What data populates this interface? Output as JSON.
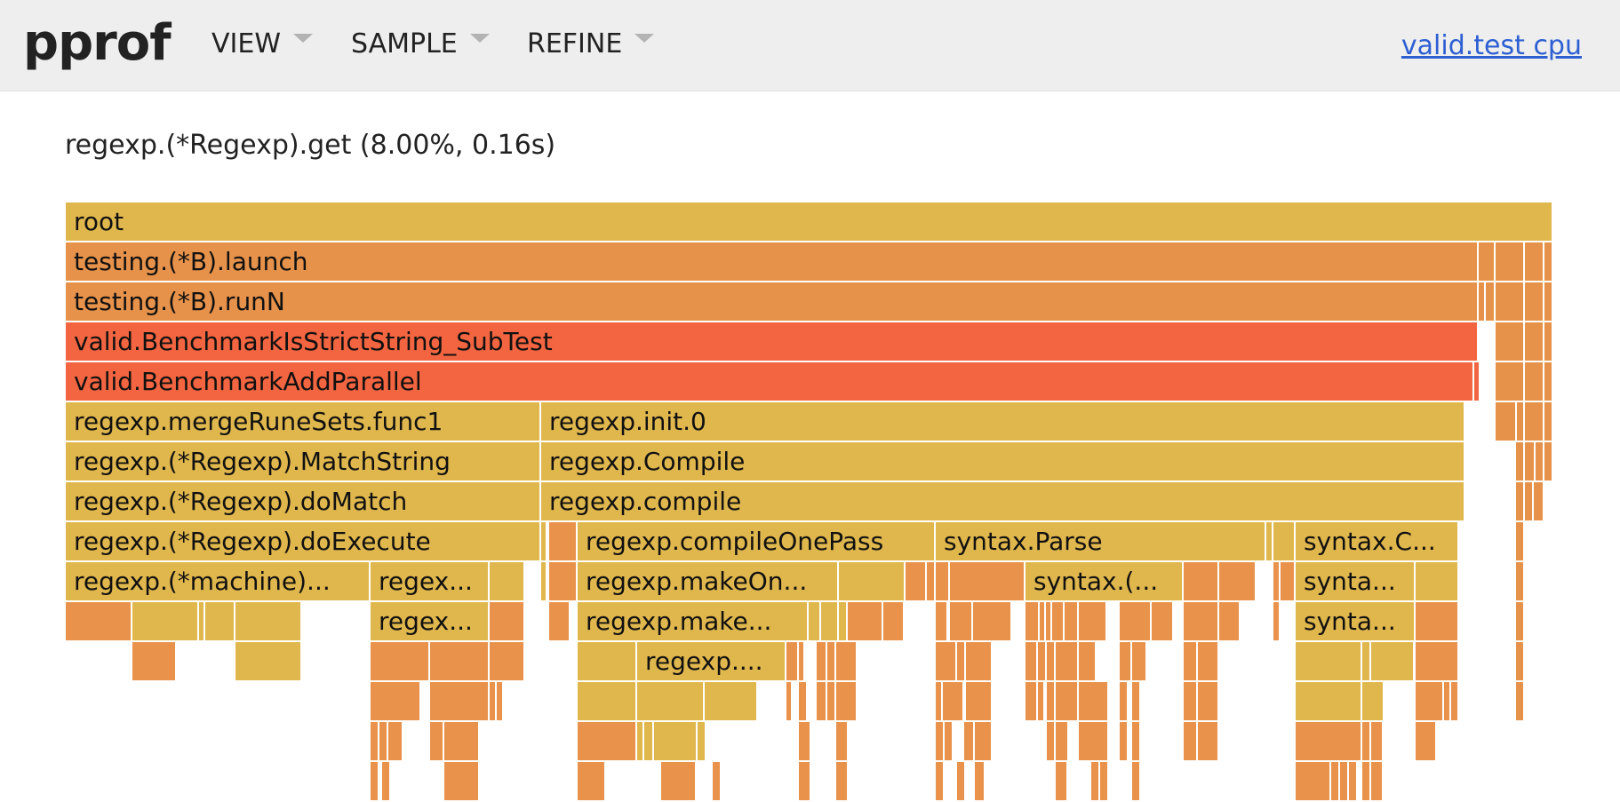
{
  "header": {
    "logo": "pprof",
    "menus": [
      {
        "label": "VIEW"
      },
      {
        "label": "SAMPLE"
      },
      {
        "label": "REFINE"
      }
    ],
    "profile_link": "valid.test cpu"
  },
  "details": "regexp.(*Regexp).get (8.00%, 0.16s)",
  "colors": {
    "header_bg": "#eeeeee",
    "link": "#2d5fd3",
    "hot": "#f26540",
    "warm": "#e6924a",
    "yellow": "#e0b74d",
    "orange": "#e9924b"
  },
  "flame": {
    "frames": [
      "root",
      "testing.(*B).launch",
      "testing.(*B).runN",
      "valid.BenchmarkIsStrictString_SubTest",
      "valid.BenchmarkAddParallel",
      "regexp.mergeRuneSets.func1",
      "regexp.init.0",
      "regexp.(*Regexp).MatchString",
      "regexp.Compile",
      "regexp.(*Regexp).doMatch",
      "regexp.compile",
      "regexp.(*Regexp).doExecute",
      "regexp.compileOnePass",
      "syntax.Parse",
      "syntax.C...",
      "regexp.(*machine)...",
      "regex...",
      "regexp.makeOn...",
      "syntax.(...",
      "synta...",
      "regex...",
      "regexp.make...",
      "synta...",
      "regexp...."
    ]
  }
}
